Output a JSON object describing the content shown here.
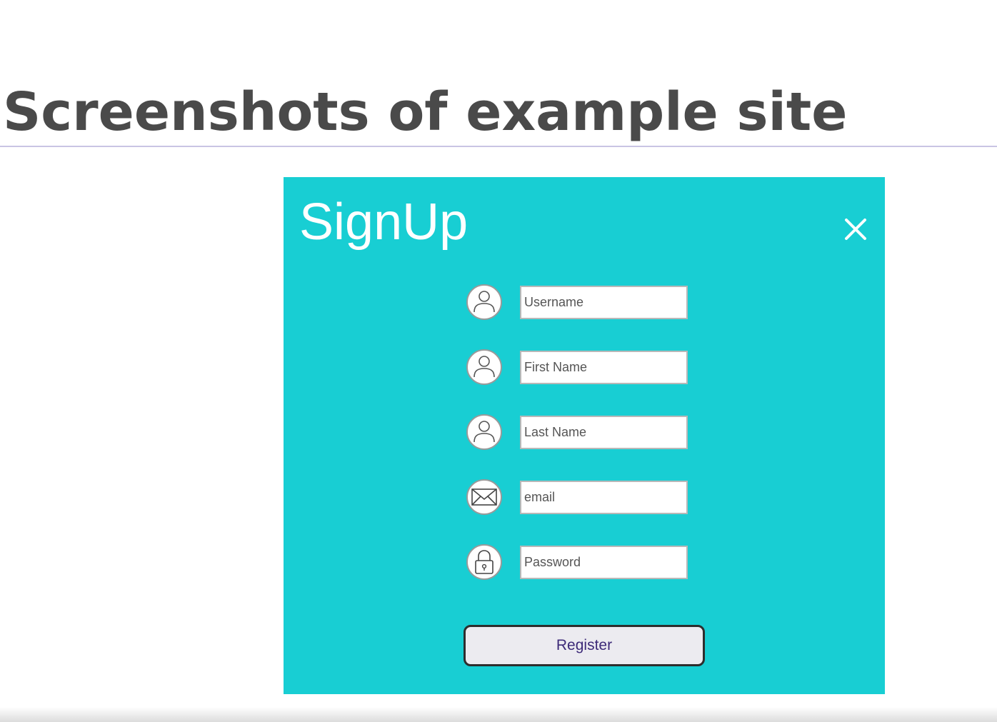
{
  "slide": {
    "title": "Screenshots of example site"
  },
  "signup": {
    "title": "SignUp",
    "close_icon": "close-icon",
    "fields": [
      {
        "icon": "user-icon",
        "placeholder": "Username"
      },
      {
        "icon": "user-icon",
        "placeholder": "First Name"
      },
      {
        "icon": "user-icon",
        "placeholder": "Last Name"
      },
      {
        "icon": "envelope-icon",
        "placeholder": "email"
      },
      {
        "icon": "lock-icon",
        "placeholder": "Password"
      }
    ],
    "register_label": "Register"
  },
  "colors": {
    "panel_background": "#18ced3",
    "title_text": "#4a4a4a",
    "title_rule": "#c9c4e4",
    "register_text": "#3d2a78",
    "register_background": "#ecebf0"
  }
}
